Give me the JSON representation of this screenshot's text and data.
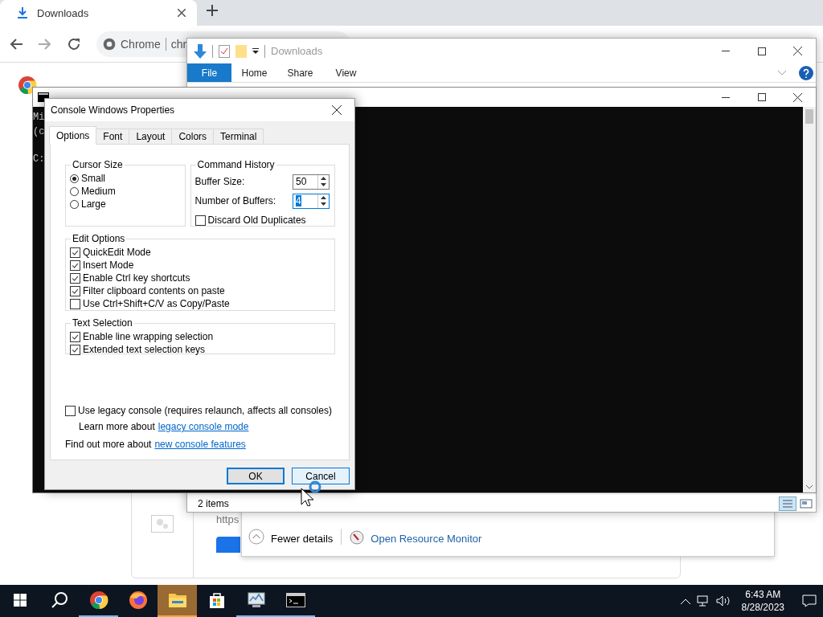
{
  "browser": {
    "tab_title": "Downloads",
    "site": "Chrome",
    "url": "chr",
    "download_url": "https"
  },
  "task_manager": {
    "fewer": "Fewer details",
    "monitor": "Open Resource Monitor"
  },
  "explorer": {
    "title": "Downloads",
    "ribbon_tabs": [
      {
        "label": "File",
        "selected": true
      },
      {
        "label": "Home",
        "selected": false
      },
      {
        "label": "Share",
        "selected": false
      },
      {
        "label": "View",
        "selected": false
      }
    ],
    "status": "2 items"
  },
  "console": {
    "lines": [
      "Mi",
      "(c",
      "C:"
    ]
  },
  "dialog": {
    "title": "Console Windows Properties",
    "tabs": [
      {
        "label": "Options",
        "selected": true
      },
      {
        "label": "Font",
        "selected": false
      },
      {
        "label": "Layout",
        "selected": false
      },
      {
        "label": "Colors",
        "selected": false
      },
      {
        "label": "Terminal",
        "selected": false
      }
    ],
    "cursor_size": {
      "title": "Cursor Size",
      "options": [
        {
          "label": "Small",
          "selected": true
        },
        {
          "label": "Medium",
          "selected": false
        },
        {
          "label": "Large",
          "selected": false
        }
      ]
    },
    "command_history": {
      "title": "Command History",
      "fields": [
        {
          "label": "Buffer Size:",
          "value": "50",
          "selected": false
        },
        {
          "label": "Number of Buffers:",
          "value": "4",
          "selected": true
        }
      ],
      "discard": {
        "label": "Discard Old Duplicates",
        "checked": false
      }
    },
    "edit_options": {
      "title": "Edit Options",
      "items": [
        {
          "label": "QuickEdit Mode",
          "checked": true
        },
        {
          "label": "Insert Mode",
          "checked": true
        },
        {
          "label": "Enable Ctrl key shortcuts",
          "checked": true
        },
        {
          "label": "Filter clipboard contents on paste",
          "checked": true
        },
        {
          "label": "Use Ctrl+Shift+C/V as Copy/Paste",
          "checked": false
        }
      ]
    },
    "text_selection": {
      "title": "Text Selection",
      "items": [
        {
          "label": "Enable line wrapping selection",
          "checked": true
        },
        {
          "label": "Extended text selection keys",
          "checked": true
        }
      ]
    },
    "legacy": {
      "label": "Use legacy console (requires relaunch, affects all consoles)",
      "checked": false
    },
    "learn": {
      "text": "Learn more about",
      "link": "legacy console mode"
    },
    "find": {
      "text": "Find out more about",
      "link": "new console features"
    },
    "buttons": [
      {
        "label": "OK",
        "default": true,
        "hovered": false
      },
      {
        "label": "Cancel",
        "default": false,
        "hovered": true
      }
    ]
  },
  "taskbar": {
    "apps": [
      {
        "kind": "start",
        "running": false,
        "selected": false
      },
      {
        "kind": "search",
        "running": false,
        "selected": false
      },
      {
        "kind": "chrome",
        "running": true,
        "selected": false
      },
      {
        "kind": "firefox",
        "running": false,
        "selected": false
      },
      {
        "kind": "folder",
        "running": true,
        "selected": true
      },
      {
        "kind": "store",
        "running": false,
        "selected": false
      },
      {
        "kind": "monitor",
        "running": true,
        "selected": false
      },
      {
        "kind": "terminal",
        "running": true,
        "selected": false
      }
    ],
    "time": "6:43 AM",
    "date": "8/28/2023"
  }
}
